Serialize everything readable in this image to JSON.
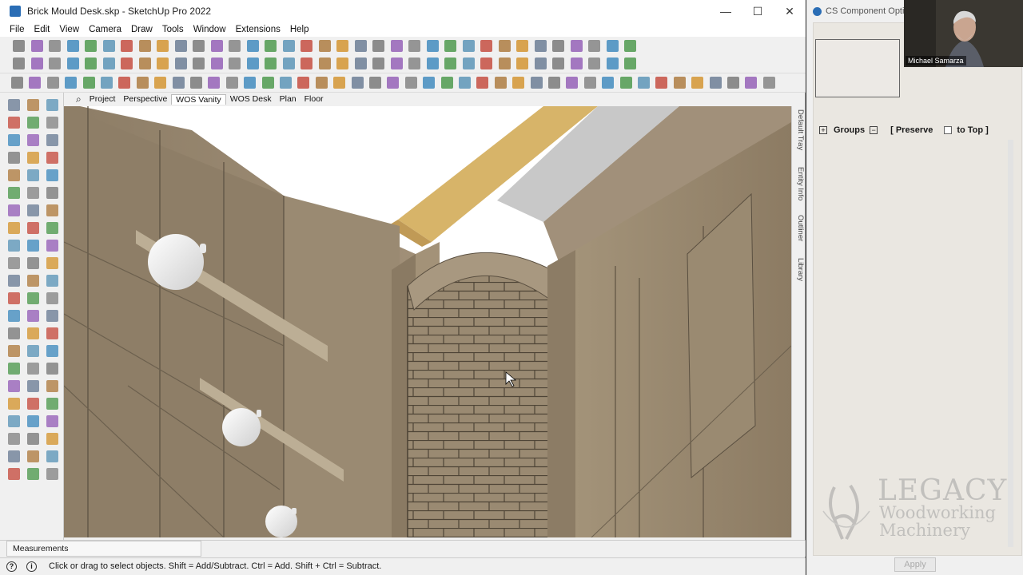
{
  "window": {
    "title": "Brick Mould Desk.skp - SketchUp Pro 2022",
    "minimize_glyph": "—",
    "maximize_glyph": "☐",
    "close_glyph": "✕"
  },
  "menu": [
    "File",
    "Edit",
    "View",
    "Camera",
    "Draw",
    "Tools",
    "Window",
    "Extensions",
    "Help"
  ],
  "scenes": {
    "search_icon": "⌕",
    "tabs": [
      "Project",
      "Perspective",
      "WOS Vanity",
      "WOS Desk",
      "Plan",
      "Floor"
    ],
    "active": "WOS Vanity"
  },
  "tray_tabs": [
    "Default Tray",
    "Entity Info",
    "Outliner",
    "Library"
  ],
  "measurements_label": "Measurements",
  "status": {
    "message": "Click or drag to select objects. Shift = Add/Subtract. Ctrl = Add. Shift + Ctrl = Subtract.",
    "icon1": "?",
    "icon2": "i"
  },
  "panel": {
    "title": "CS Component Options",
    "groups_label": "Groups",
    "preserve_label": "[ Preserve",
    "totop_label": "to Top ]",
    "expand_glyph": "+",
    "collapse_glyph": "−",
    "apply_label": "Apply"
  },
  "webcam": {
    "name": "Michael Samarza"
  },
  "watermark": {
    "line1": "LEGACY",
    "line2": "Woodworking",
    "line3": "Machinery"
  },
  "colors": {
    "wood_dark": "#8a7a64",
    "wood_mid": "#9c8c74",
    "wood_light": "#b0a088",
    "osb": "#d8b56a",
    "gray_panel": "#c8c8c8",
    "accent_blue": "#2a6db5"
  }
}
